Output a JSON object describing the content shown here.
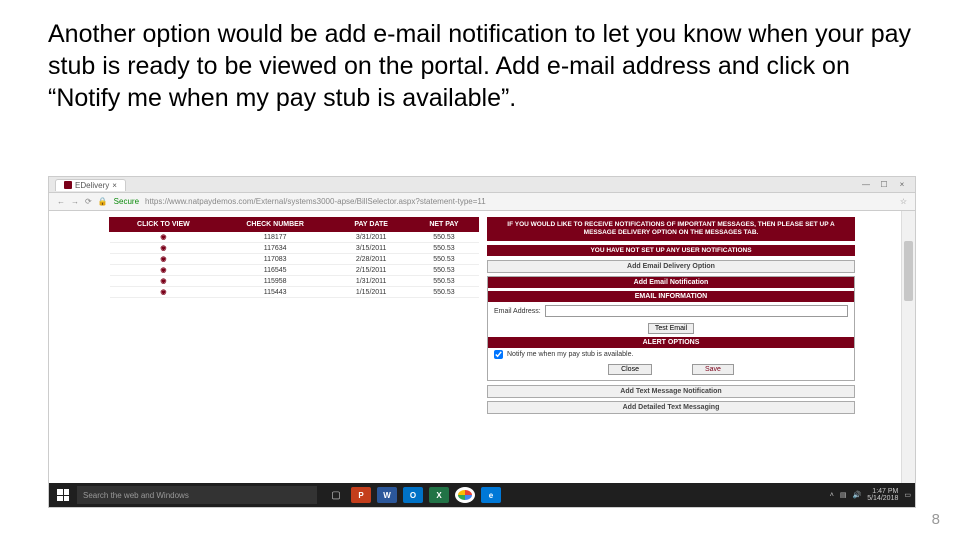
{
  "instruction_text": "Another option would be add e-mail notification to let you know when your pay stub is ready to be viewed on the portal.   Add e-mail address and click on “Notify me when my pay stub is available”.",
  "slide_number": "8",
  "browser": {
    "tab_title": "EDelivery",
    "secure_label": "Secure",
    "url": "https://www.natpaydemos.com/External/systems3000-apse/BillSelector.aspx?statement-type=11",
    "taskbar_search_placeholder": "Search the web and Windows",
    "tray_time": "1:47 PM",
    "tray_date": "5/14/2018"
  },
  "table": {
    "headers": [
      "CLICK TO VIEW",
      "CHECK NUMBER",
      "PAY DATE",
      "NET PAY"
    ],
    "rows": [
      {
        "check": "118177",
        "date": "3/31/2011",
        "net": "550.53"
      },
      {
        "check": "117634",
        "date": "3/15/2011",
        "net": "550.53"
      },
      {
        "check": "117083",
        "date": "2/28/2011",
        "net": "550.53"
      },
      {
        "check": "116545",
        "date": "2/15/2011",
        "net": "550.53"
      },
      {
        "check": "115958",
        "date": "1/31/2011",
        "net": "550.53"
      },
      {
        "check": "115443",
        "date": "1/15/2011",
        "net": "550.53"
      }
    ]
  },
  "right": {
    "notice": "IF YOU WOULD LIKE TO RECEIVE NOTIFICATIONS OF IMPORTANT MESSAGES, THEN PLEASE SET UP A MESSAGE DELIVERY OPTION ON THE MESSAGES TAB.",
    "no_notifications": "YOU HAVE NOT SET UP ANY USER NOTIFICATIONS",
    "add_delivery": "Add Email Delivery Option",
    "add_email_notification": "Add Email Notification",
    "email_info": "EMAIL INFORMATION",
    "email_label": "Email Address:",
    "test_email_btn": "Test Email",
    "alert_options": "ALERT OPTIONS",
    "notify_checkbox_label": "Notify me when my pay stub is available.",
    "close_btn": "Close",
    "save_btn": "Save",
    "add_text_msg": "Add Text Message Notification",
    "add_detailed": "Add Detailed Text Messaging"
  }
}
